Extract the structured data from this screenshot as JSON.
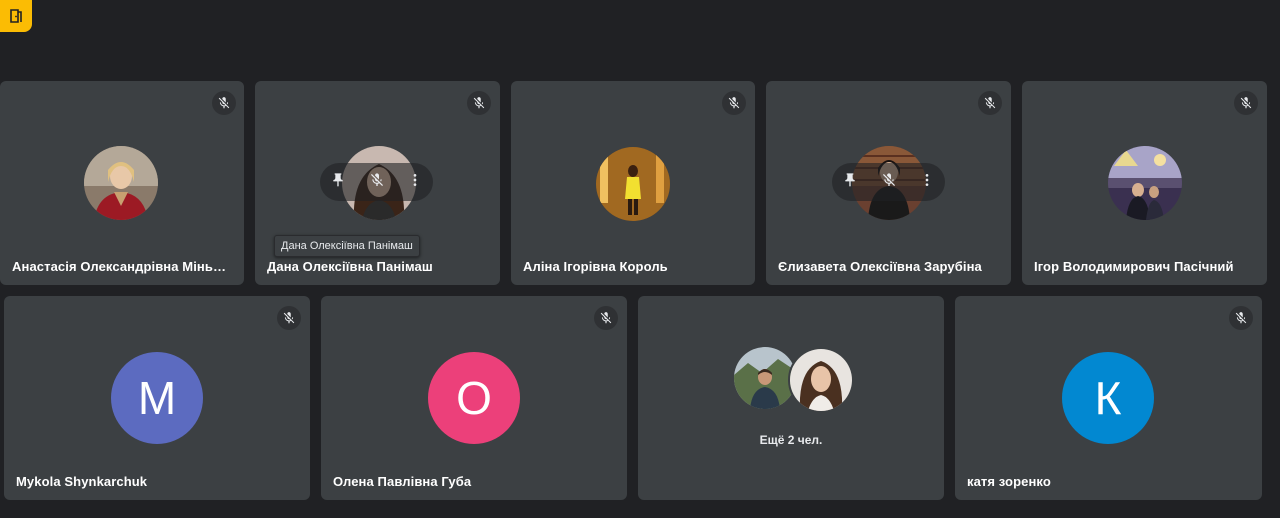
{
  "toolbar": {
    "corner_icon": "door-exit-icon"
  },
  "row1": [
    {
      "name": "Анастасія Олександрівна Міньковс...",
      "avatar": "photo",
      "muted": true
    },
    {
      "name": "Дана Олексіївна Панімаш",
      "avatar": "photo",
      "muted": true,
      "tooltip": "Дана Олексіївна Панімаш",
      "hovered": true
    },
    {
      "name": "Аліна Ігорівна Король",
      "avatar": "photo",
      "muted": true
    },
    {
      "name": "Єлизавета Олексіївна Зарубіна",
      "avatar": "photo",
      "muted": true,
      "hovered": true
    },
    {
      "name": "Ігор Володимирович Пасічний",
      "avatar": "photo",
      "muted": true
    }
  ],
  "row2": [
    {
      "name": "Mykola Shynkarchuk",
      "avatar_letter": "M",
      "avatar_color": "#5c6bc0",
      "muted": true
    },
    {
      "name": "Олена Павлівна Губа",
      "avatar_letter": "О",
      "avatar_color": "#ec407a",
      "muted": true
    },
    {
      "more_label": "Ещё 2 чел."
    },
    {
      "name": "катя зоренко",
      "avatar_letter": "К",
      "avatar_color": "#0288d1",
      "muted": true
    }
  ],
  "colors": {
    "background": "#202124",
    "tile": "#3c4043",
    "corner_button": "#fbbc04"
  },
  "icons": {
    "mute": "mic-off-icon",
    "pin": "pin-icon",
    "more": "more-vert-icon"
  }
}
